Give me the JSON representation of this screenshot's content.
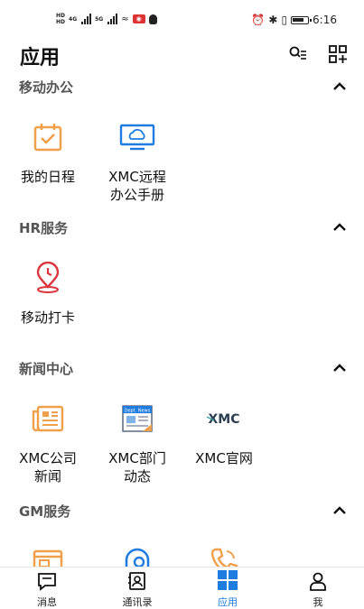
{
  "status_bar": {
    "network_a": "4G",
    "network_b": "5G",
    "time": "6:16"
  },
  "header": {
    "title": "应用"
  },
  "sections": [
    {
      "title": "移动办公",
      "apps": [
        {
          "label_lines": [
            "我的日程",
            ""
          ],
          "icon": "calendar-check-icon"
        },
        {
          "label_lines": [
            "XMC远程",
            "办公手册"
          ],
          "icon": "monitor-cloud-icon"
        }
      ]
    },
    {
      "title": "HR服务",
      "apps": [
        {
          "label_lines": [
            "移动打卡",
            ""
          ],
          "icon": "location-clock-icon"
        }
      ]
    },
    {
      "title": "新闻中心",
      "apps": [
        {
          "label_lines": [
            "XMC公司",
            "新闻"
          ],
          "icon": "newspaper-icon"
        },
        {
          "label_lines": [
            "XMC部门",
            "动态"
          ],
          "icon": "dept-news-icon",
          "icon_text": "Dept. News"
        },
        {
          "label_lines": [
            "XMC官网",
            ""
          ],
          "icon": "xmc-logo-icon",
          "icon_text": "XMC"
        }
      ]
    },
    {
      "title": "GM服务",
      "apps": [
        {
          "icon": "card-icon"
        },
        {
          "icon": "headset-icon"
        },
        {
          "icon": "phone-icon"
        }
      ]
    }
  ],
  "tabs": [
    {
      "label": "消息",
      "icon": "message-icon"
    },
    {
      "label": "通讯录",
      "icon": "contacts-icon"
    },
    {
      "label": "应用",
      "icon": "apps-grid-icon",
      "active": true
    },
    {
      "label": "我",
      "icon": "person-icon"
    }
  ],
  "colors": {
    "accent_orange": "#F0A04B",
    "accent_blue": "#1E7BE0",
    "accent_red": "#D9363E"
  }
}
